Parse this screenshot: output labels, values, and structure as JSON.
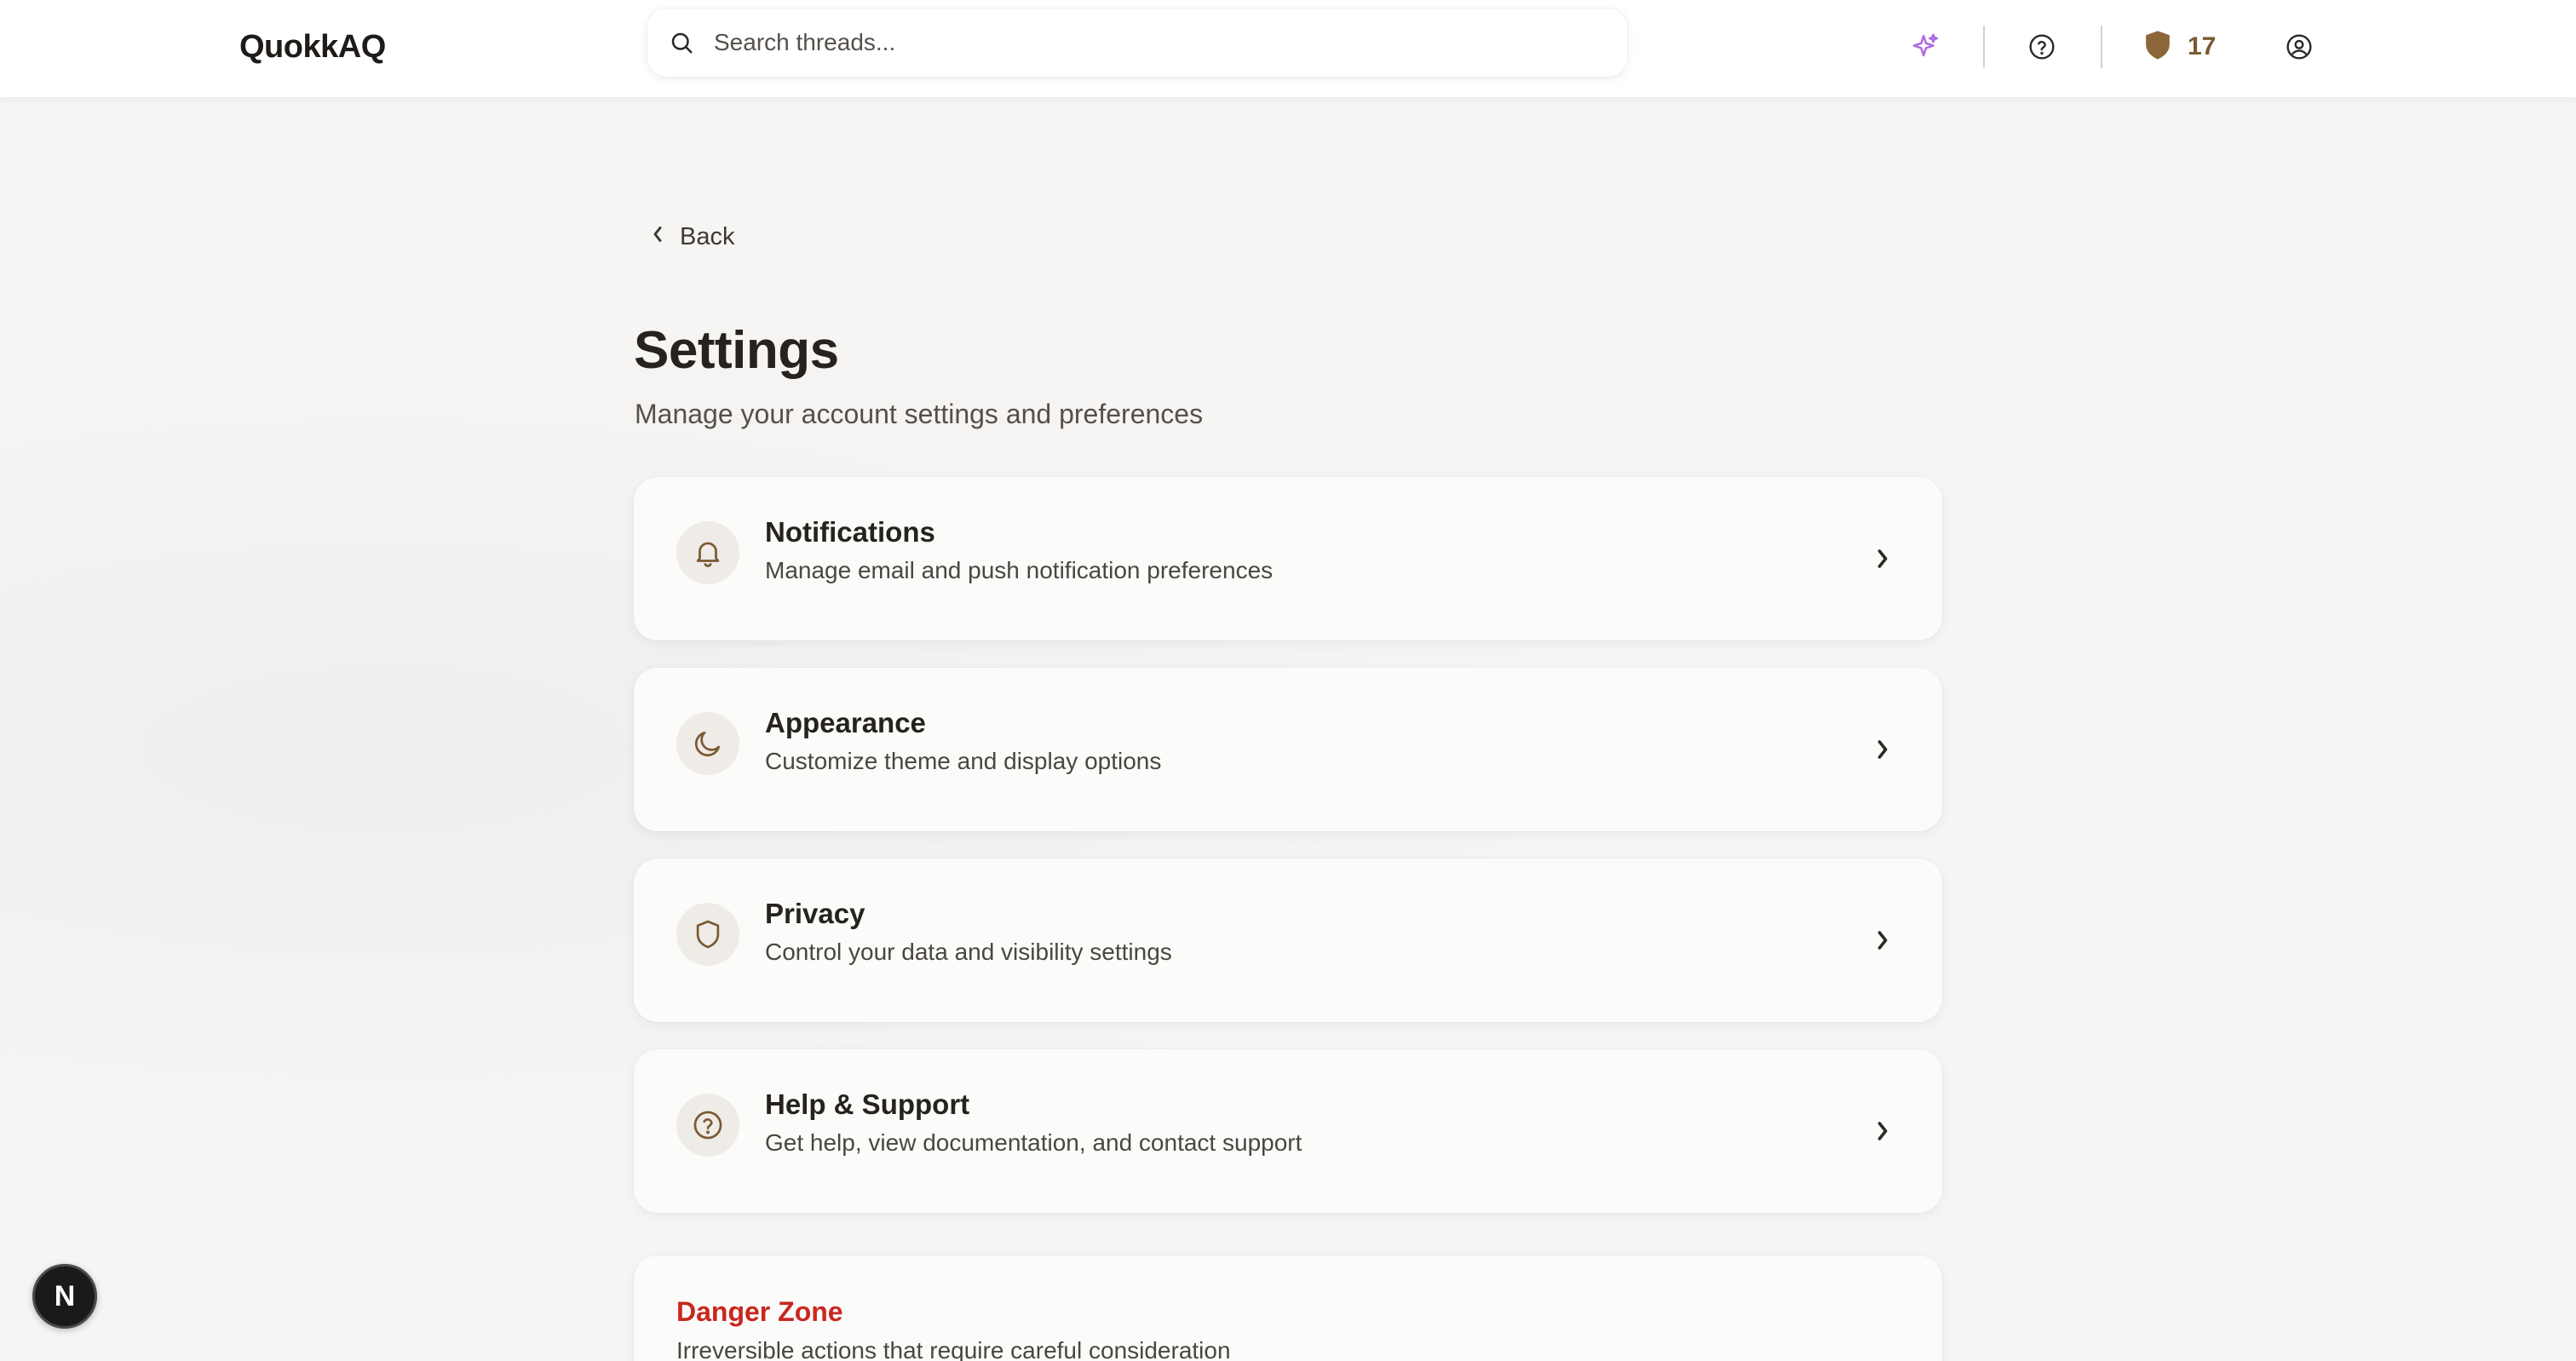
{
  "app": {
    "logo": "QuokkAQ"
  },
  "search": {
    "placeholder": "Search threads..."
  },
  "header": {
    "points": "17",
    "icons": [
      "sparkle-icon",
      "help-circle-icon",
      "shield-icon",
      "user-circle-icon"
    ],
    "accent_color": "#b06be0",
    "points_color": "#7a5a33"
  },
  "page": {
    "back_label": "Back",
    "title": "Settings",
    "subtitle": "Manage your account settings and preferences"
  },
  "cards": [
    {
      "title": "Notifications",
      "description": "Manage email and push notification preferences",
      "icon": "bell-icon"
    },
    {
      "title": "Appearance",
      "description": "Customize theme and display options",
      "icon": "moon-icon"
    },
    {
      "title": "Privacy",
      "description": "Control your data and visibility settings",
      "icon": "shield-icon"
    },
    {
      "title": "Help & Support",
      "description": "Get help, view documentation, and contact support",
      "icon": "help-circle-icon"
    }
  ],
  "danger": {
    "title": "Danger Zone",
    "description": "Irreversible actions that require careful consideration",
    "color": "#c9271f"
  },
  "dev_badge": {
    "label": "N"
  }
}
